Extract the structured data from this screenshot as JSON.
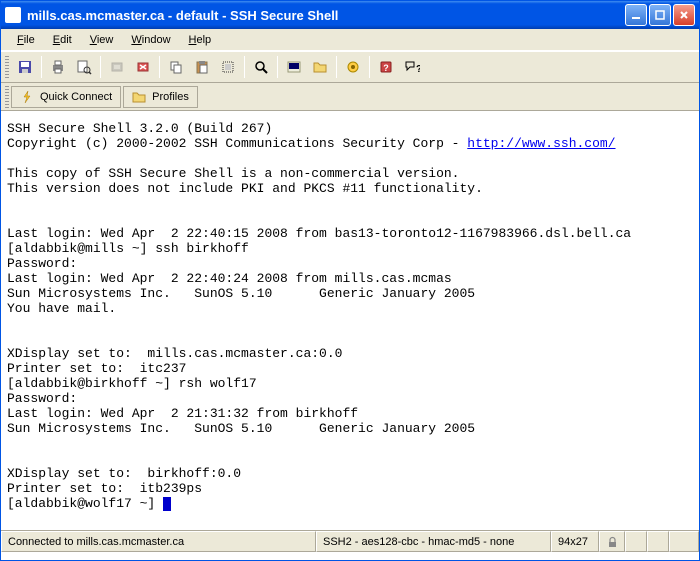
{
  "window": {
    "title": "mills.cas.mcmaster.ca - default - SSH Secure Shell"
  },
  "menu": {
    "file": "File",
    "edit": "Edit",
    "view": "View",
    "window": "Window",
    "help": "Help"
  },
  "connectbar": {
    "quick_connect": "Quick Connect",
    "profiles": "Profiles"
  },
  "terminal": {
    "line1": "SSH Secure Shell 3.2.0 (Build 267)",
    "line2a": "Copyright (c) 2000-2002 SSH Communications Security Corp - ",
    "line2b": "http://www.ssh.com/",
    "line4": "This copy of SSH Secure Shell is a non-commercial version.",
    "line5": "This version does not include PKI and PKCS #11 functionality.",
    "line8": "Last login: Wed Apr  2 22:40:15 2008 from bas13-toronto12-1167983966.dsl.bell.ca",
    "line9": "[aldabbik@mills ~] ssh birkhoff",
    "line10": "Password:",
    "line11": "Last login: Wed Apr  2 22:40:24 2008 from mills.cas.mcmas",
    "line12": "Sun Microsystems Inc.   SunOS 5.10      Generic January 2005",
    "line13": "You have mail.",
    "line16": "XDisplay set to:  mills.cas.mcmaster.ca:0.0",
    "line17": "Printer set to:  itc237",
    "line18": "[aldabbik@birkhoff ~] rsh wolf17",
    "line19": "Password:",
    "line20": "Last login: Wed Apr  2 21:31:32 from birkhoff",
    "line21": "Sun Microsystems Inc.   SunOS 5.10      Generic January 2005",
    "line24": "XDisplay set to:  birkhoff:0.0",
    "line25": "Printer set to:  itb239ps",
    "line26": "[aldabbik@wolf17 ~] "
  },
  "status": {
    "connection": "Connected to mills.cas.mcmaster.ca",
    "cipher": "SSH2 - aes128-cbc - hmac-md5 - none",
    "size": "94x27"
  }
}
